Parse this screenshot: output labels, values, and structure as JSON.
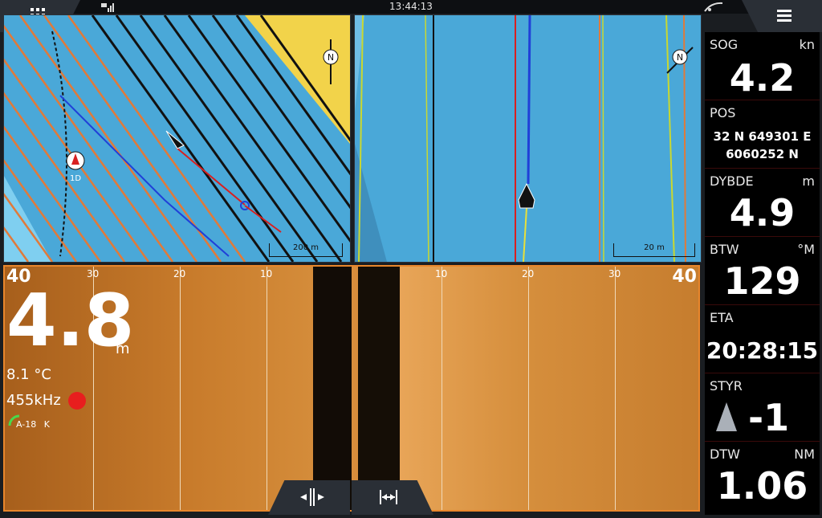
{
  "status": {
    "clock": "13:44:13"
  },
  "charts": {
    "left": {
      "scale": "200 m",
      "north": "N",
      "marker": "1D"
    },
    "right": {
      "scale": "20 m",
      "north": "N"
    }
  },
  "sonar": {
    "range_left": "40",
    "range_right": "40",
    "ticks_left": [
      "30",
      "20",
      "10"
    ],
    "ticks_right": [
      "10",
      "20",
      "30"
    ],
    "depth": "4.8",
    "depth_unit": "m",
    "temperature": "8.1 °C",
    "frequency": "455kHz",
    "gain": "A-18",
    "gain_suffix": "K"
  },
  "databar": [
    {
      "label": "SOG",
      "unit": "kn",
      "value": "4.2"
    },
    {
      "label": "POS",
      "unit": "",
      "value_line1": "32 N  649301 E",
      "value_line2": "6060252 N"
    },
    {
      "label": "DYBDE",
      "unit": "m",
      "value": "4.9"
    },
    {
      "label": "BTW",
      "unit": "°M",
      "value": "129"
    },
    {
      "label": "ETA",
      "unit": "",
      "value": "20:28:15"
    },
    {
      "label": "STYR",
      "unit": "",
      "value": "-1"
    },
    {
      "label": "DTW",
      "unit": "NM",
      "value": "1.06"
    }
  ],
  "icons": [
    "apps-grid-icon",
    "menu-icon",
    "satellite-icon",
    "signal-icon",
    "north-arrow-icon",
    "vessel-icon",
    "record-icon",
    "gain-arc-icon",
    "steer-arrow-icon",
    "split-collapse-icon",
    "split-expand-icon"
  ],
  "colors": {
    "accent": "#e8862b",
    "water": "#4aa8d8",
    "land": "#f2d34a",
    "record": "#e81e1e"
  }
}
